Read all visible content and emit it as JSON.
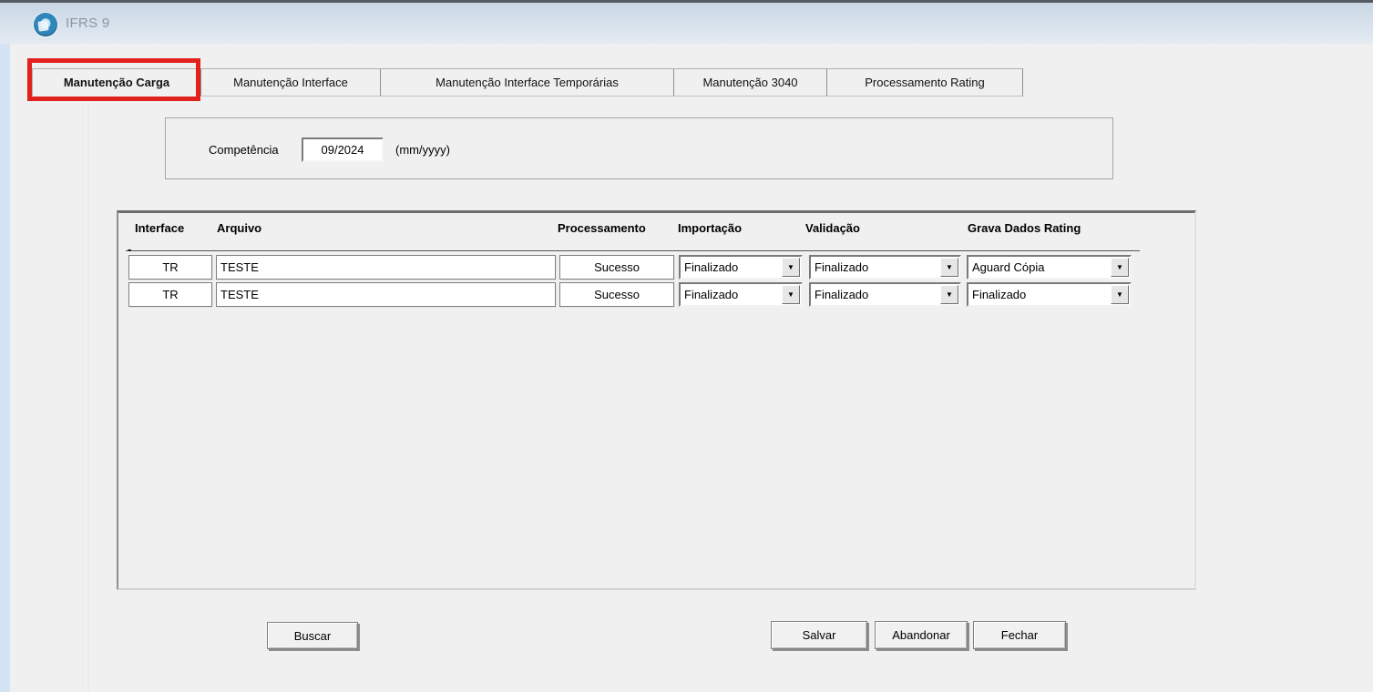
{
  "window": {
    "title": "IFRS 9"
  },
  "tabs": [
    {
      "label": "Manutenção Carga",
      "active": true
    },
    {
      "label": "Manutenção Interface",
      "active": false
    },
    {
      "label": "Manutenção Interface Temporárias",
      "active": false
    },
    {
      "label": "Manutenção 3040",
      "active": false
    },
    {
      "label": "Processamento Rating",
      "active": false
    }
  ],
  "filter": {
    "label": "Competência",
    "value": "09/2024",
    "format_hint": "(mm/yyyy)"
  },
  "grid": {
    "columns": [
      "Interface",
      "Arquivo",
      "Processamento",
      "Importação",
      "Validação",
      "Grava Dados Rating"
    ],
    "row_indicator": "-",
    "rows": [
      {
        "interface": "TR",
        "arquivo": "TESTE",
        "processamento": "Sucesso",
        "importacao": "Finalizado",
        "validacao": "Finalizado",
        "grava_dados_rating": "Aguard Cópia"
      },
      {
        "interface": "TR",
        "arquivo": "TESTE",
        "processamento": "Sucesso",
        "importacao": "Finalizado",
        "validacao": "Finalizado",
        "grava_dados_rating": "Finalizado"
      }
    ]
  },
  "actions": {
    "buscar": "Buscar",
    "salvar": "Salvar",
    "abandonar": "Abandonar",
    "fechar": "Fechar"
  },
  "glyphs": {
    "dropdown_arrow": "▼"
  },
  "colors": {
    "annotation_red": "#e2211c",
    "left_border_blue": "#d5e4f4",
    "titlebar_gradient_top": "#c9d6e4",
    "titlebar_gradient_bottom": "#e3eaf2",
    "content_bg": "#f0f0f0"
  }
}
